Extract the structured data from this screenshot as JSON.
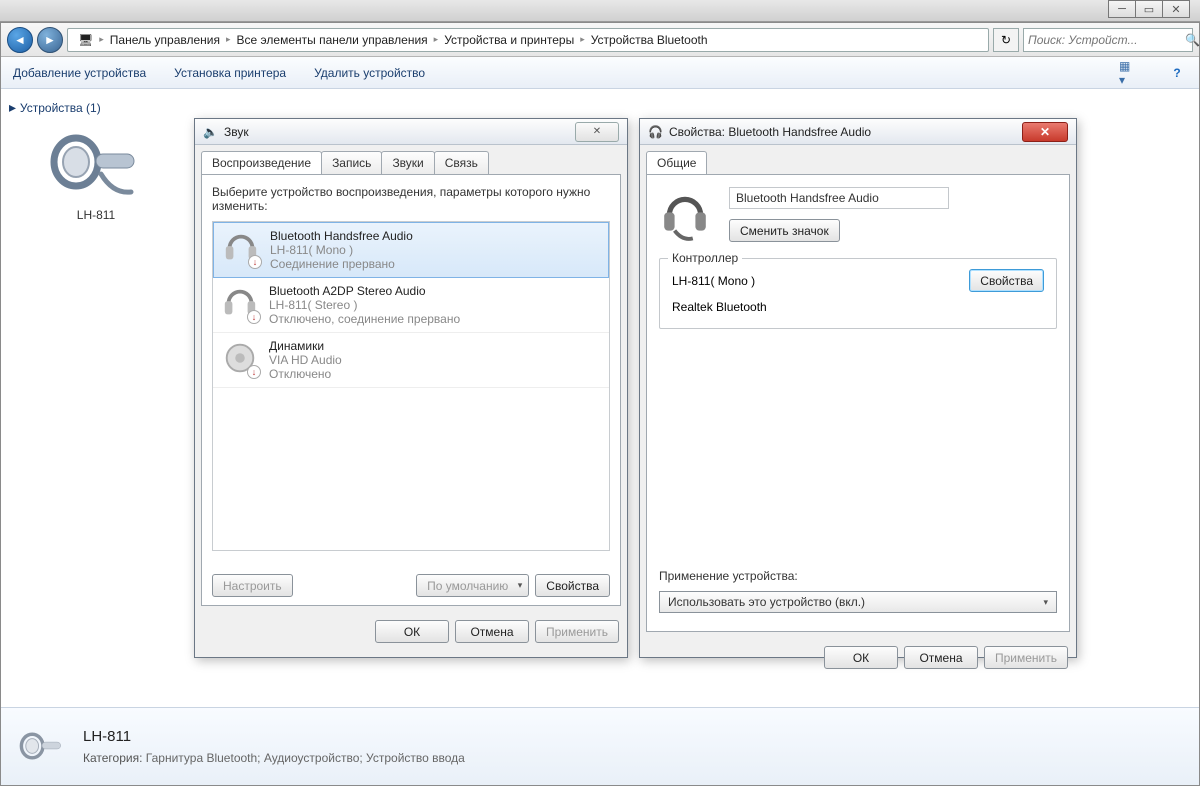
{
  "breadcrumb": [
    "Панель управления",
    "Все элементы панели управления",
    "Устройства и принтеры",
    "Устройства Bluetooth"
  ],
  "search_placeholder": "Поиск: Устройст...",
  "toolbar": {
    "add_device": "Добавление устройства",
    "add_printer": "Установка принтера",
    "remove_device": "Удалить устройство"
  },
  "side": {
    "header": "Устройства (1)",
    "device_label": "LH-811"
  },
  "details": {
    "title": "LH-811",
    "category_label": "Категория:",
    "category_value": "Гарнитура Bluetooth; Аудиоустройство; Устройство ввода"
  },
  "sound_dialog": {
    "title": "Звук",
    "tabs": [
      "Воспроизведение",
      "Запись",
      "Звуки",
      "Связь"
    ],
    "instruction": "Выберите устройство воспроизведения, параметры которого нужно изменить:",
    "devices": [
      {
        "name": "Bluetooth Handsfree Audio",
        "sub": "LH-811( Mono )",
        "status": "Соединение прервано"
      },
      {
        "name": "Bluetooth A2DP Stereo Audio",
        "sub": "LH-811( Stereo )",
        "status": "Отключено, соединение прервано"
      },
      {
        "name": "Динамики",
        "sub": "VIA HD Audio",
        "status": "Отключено"
      }
    ],
    "btn_configure": "Настроить",
    "btn_default": "По умолчанию",
    "btn_props": "Свойства",
    "btn_ok": "ОК",
    "btn_cancel": "Отмена",
    "btn_apply": "Применить"
  },
  "props_dialog": {
    "title": "Свойства: Bluetooth Handsfree Audio",
    "tab": "Общие",
    "device_name": "Bluetooth Handsfree Audio",
    "change_icon": "Сменить значок",
    "controller_label": "Контроллер",
    "controller_line1": "LH-811( Mono )",
    "controller_line2": "Realtek Bluetooth",
    "btn_props": "Свойства",
    "usage_label": "Применение устройства:",
    "usage_value": "Использовать это устройство (вкл.)",
    "btn_ok": "ОК",
    "btn_cancel": "Отмена",
    "btn_apply": "Применить"
  }
}
